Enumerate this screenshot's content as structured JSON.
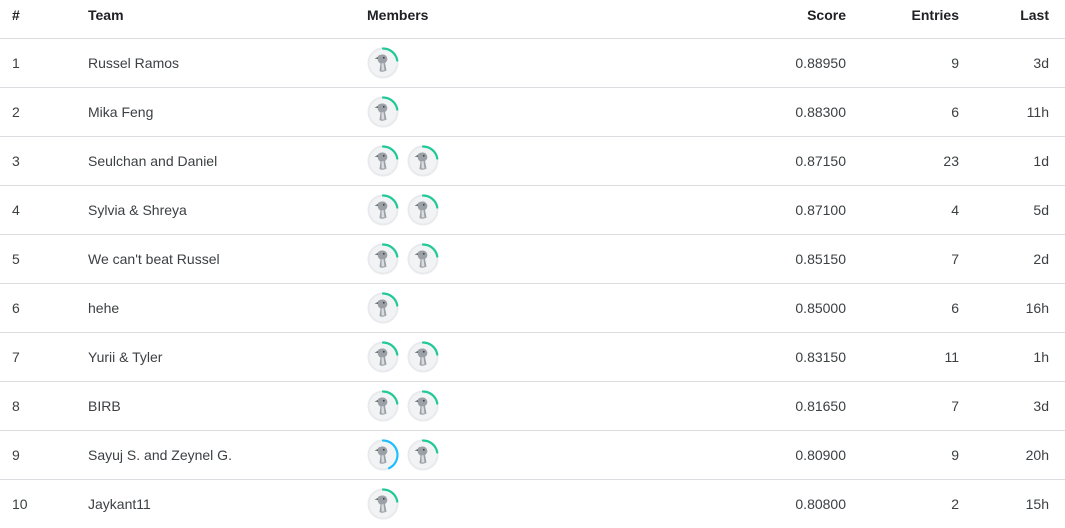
{
  "headers": {
    "rank": "#",
    "team": "Team",
    "members": "Members",
    "score": "Score",
    "entries": "Entries",
    "last": "Last"
  },
  "colors": {
    "tier_green": "#20beff",
    "ring_green": "#20c997",
    "ring_blue": "#20beff",
    "divider": "#dadce0"
  },
  "rows": [
    {
      "rank": "1",
      "team": "Russel Ramos",
      "members": [
        "green"
      ],
      "score": "0.88950",
      "entries": "9",
      "last": "3d"
    },
    {
      "rank": "2",
      "team": "Mika Feng",
      "members": [
        "green"
      ],
      "score": "0.88300",
      "entries": "6",
      "last": "11h"
    },
    {
      "rank": "3",
      "team": "Seulchan and Daniel",
      "members": [
        "green",
        "green"
      ],
      "score": "0.87150",
      "entries": "23",
      "last": "1d"
    },
    {
      "rank": "4",
      "team": "Sylvia & Shreya",
      "members": [
        "green",
        "green"
      ],
      "score": "0.87100",
      "entries": "4",
      "last": "5d"
    },
    {
      "rank": "5",
      "team": "We can't beat Russel",
      "members": [
        "green",
        "green"
      ],
      "score": "0.85150",
      "entries": "7",
      "last": "2d"
    },
    {
      "rank": "6",
      "team": "hehe",
      "members": [
        "green"
      ],
      "score": "0.85000",
      "entries": "6",
      "last": "16h"
    },
    {
      "rank": "7",
      "team": "Yurii & Tyler",
      "members": [
        "green",
        "green"
      ],
      "score": "0.83150",
      "entries": "11",
      "last": "1h"
    },
    {
      "rank": "8",
      "team": "BIRB",
      "members": [
        "green",
        "green"
      ],
      "score": "0.81650",
      "entries": "7",
      "last": "3d"
    },
    {
      "rank": "9",
      "team": "Sayuj S. and Zeynel G.",
      "members": [
        "blue",
        "green"
      ],
      "score": "0.80900",
      "entries": "9",
      "last": "20h"
    },
    {
      "rank": "10",
      "team": "Jaykant11",
      "members": [
        "green"
      ],
      "score": "0.80800",
      "entries": "2",
      "last": "15h"
    }
  ]
}
